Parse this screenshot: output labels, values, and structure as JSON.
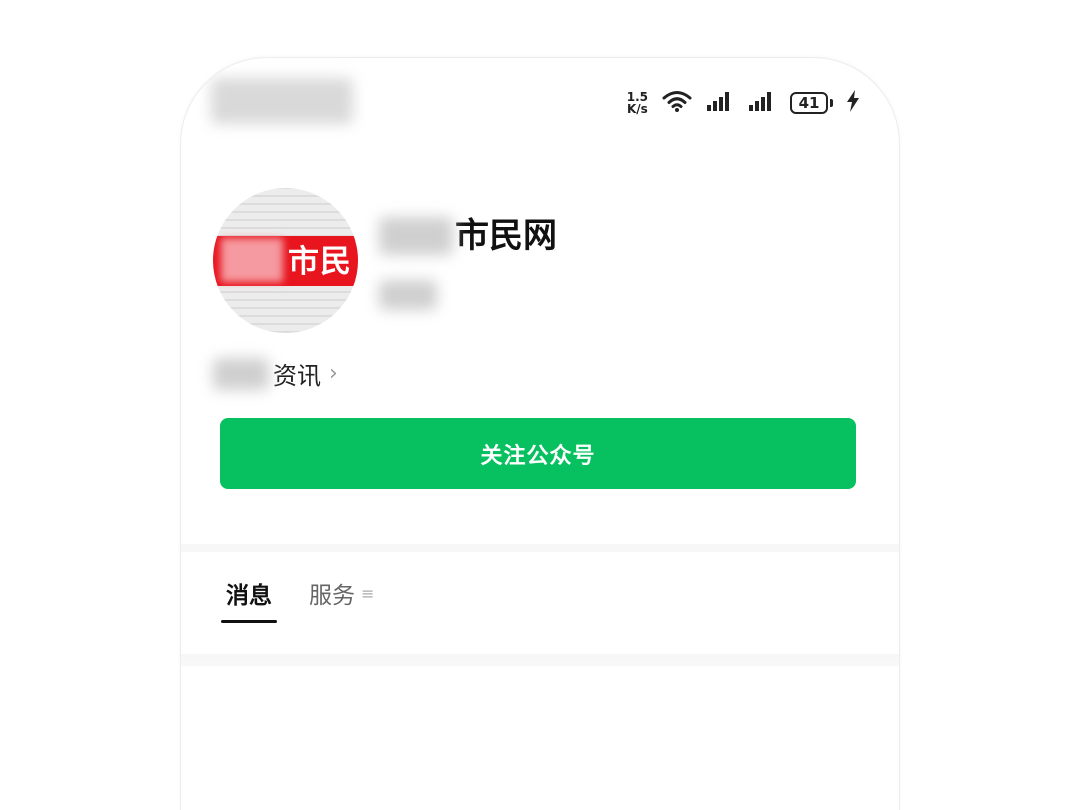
{
  "status_bar": {
    "speed_value": "1.5",
    "speed_unit": "K/s",
    "battery_level": "41"
  },
  "account": {
    "avatar_text": "市民",
    "name_suffix": "市民网"
  },
  "info_link": {
    "label_suffix": "资讯",
    "chevron": "›"
  },
  "follow_button": {
    "label": "关注公众号",
    "color": "#07c160"
  },
  "tabs": [
    {
      "label": "消息",
      "active": true
    },
    {
      "label": "服务",
      "active": false
    }
  ],
  "icons": [
    "wifi-icon",
    "signal-icon",
    "battery-icon",
    "charging-icon",
    "chevron-right-icon",
    "menu-icon"
  ]
}
